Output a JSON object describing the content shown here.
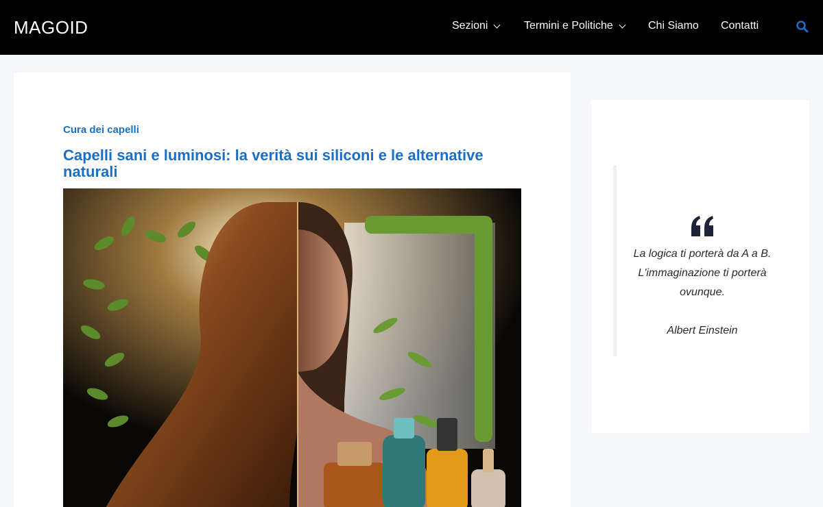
{
  "header": {
    "logo": "MAGOID",
    "nav": [
      {
        "label": "Sezioni",
        "has_dropdown": true
      },
      {
        "label": "Termini e Politiche",
        "has_dropdown": true
      },
      {
        "label": "Chi Siamo",
        "has_dropdown": false
      },
      {
        "label": "Contatti",
        "has_dropdown": false
      }
    ],
    "search_icon": "search-icon",
    "search_color": "#1a6fc4"
  },
  "article": {
    "category": "Cura dei capelli",
    "title": "Capelli sani e luminosi: la verità sui siliconi e le alternative naturali",
    "accent_color": "#1a6fc4"
  },
  "sidebar": {
    "quote_icon": "quote-icon",
    "quote": "La logica ti porterà da A a B. L'immaginazione ti porterà ovunque.",
    "author": "Albert Einstein"
  }
}
